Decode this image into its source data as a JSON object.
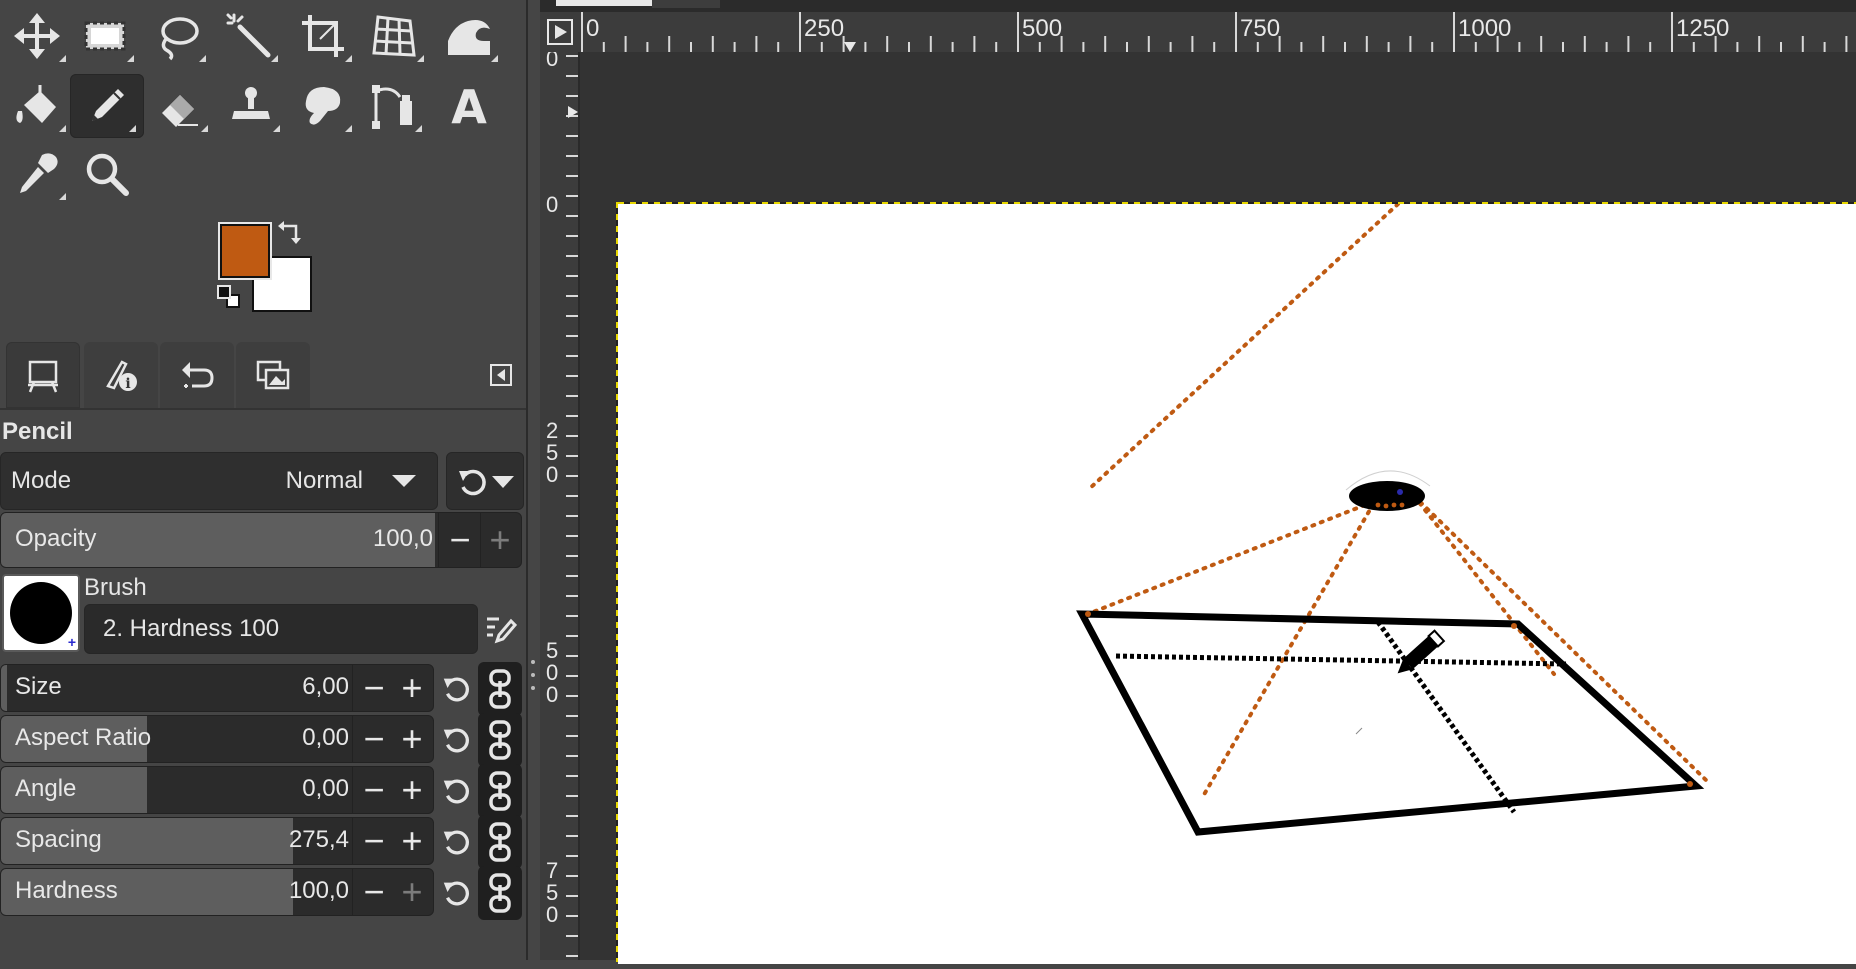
{
  "toolbox": {
    "tools": [
      {
        "name": "move-tool",
        "icon": "move-icon"
      },
      {
        "name": "rect-select-tool",
        "icon": "rect-select-icon"
      },
      {
        "name": "free-select-tool",
        "icon": "lasso-icon"
      },
      {
        "name": "fuzzy-select-tool",
        "icon": "magic-wand-icon"
      },
      {
        "name": "crop-tool",
        "icon": "crop-icon"
      },
      {
        "name": "transform-tool",
        "icon": "perspective-grid-icon"
      },
      {
        "name": "warp-tool",
        "icon": "warp-wave-icon"
      },
      {
        "name": "bucket-fill-tool",
        "icon": "bucket-fill-icon"
      },
      {
        "name": "pencil-tool",
        "icon": "pencil-icon",
        "active": true
      },
      {
        "name": "eraser-tool",
        "icon": "eraser-icon"
      },
      {
        "name": "clone-tool",
        "icon": "clone-stamp-icon"
      },
      {
        "name": "smudge-tool",
        "icon": "smudge-icon"
      },
      {
        "name": "paths-tool",
        "icon": "paths-icon"
      },
      {
        "name": "text-tool",
        "icon": "text-icon",
        "glyph": "A"
      },
      {
        "name": "color-picker-tool",
        "icon": "eyedropper-icon"
      },
      {
        "name": "zoom-tool",
        "icon": "zoom-icon"
      }
    ],
    "foreground_color": "#BF5A12",
    "background_color": "#FFFFFF"
  },
  "dock_tabs": [
    {
      "name": "tool-options-tab",
      "icon": "easel-icon",
      "active": true
    },
    {
      "name": "device-status-tab",
      "icon": "device-status-icon"
    },
    {
      "name": "undo-history-tab",
      "icon": "undo-icon"
    },
    {
      "name": "images-tab",
      "icon": "images-icon"
    }
  ],
  "tool_options": {
    "title": "Pencil",
    "mode_label": "Mode",
    "mode_value": "Normal",
    "opacity_label": "Opacity",
    "opacity_value": "100,0",
    "opacity_fraction": 1.0,
    "brush_label": "Brush",
    "brush_value": "2. Hardness 100",
    "sliders": [
      {
        "key": "size",
        "label": "Size",
        "value": "6,00",
        "fill": 0.02,
        "plus_dim": false
      },
      {
        "key": "aspect",
        "label": "Aspect Ratio",
        "value": "0,00",
        "fill": 0.5,
        "plus_dim": false
      },
      {
        "key": "angle",
        "label": "Angle",
        "value": "0,00",
        "fill": 0.5,
        "plus_dim": false
      },
      {
        "key": "spacing",
        "label": "Spacing",
        "value": "275,4",
        "fill": 1.0,
        "plus_dim": false
      },
      {
        "key": "hardness",
        "label": "Hardness",
        "value": "100,0",
        "fill": 1.0,
        "plus_dim": true
      }
    ]
  },
  "rulers": {
    "horizontal_labels": [
      "0",
      "250",
      "500",
      "750",
      "1000",
      "1250"
    ],
    "vertical_labels": [
      "0",
      "0",
      "250",
      "500",
      "750"
    ]
  },
  "colors": {
    "accent_brown": "#BF5A12",
    "canvas_bg": "#333333",
    "panel_bg": "#454545"
  }
}
